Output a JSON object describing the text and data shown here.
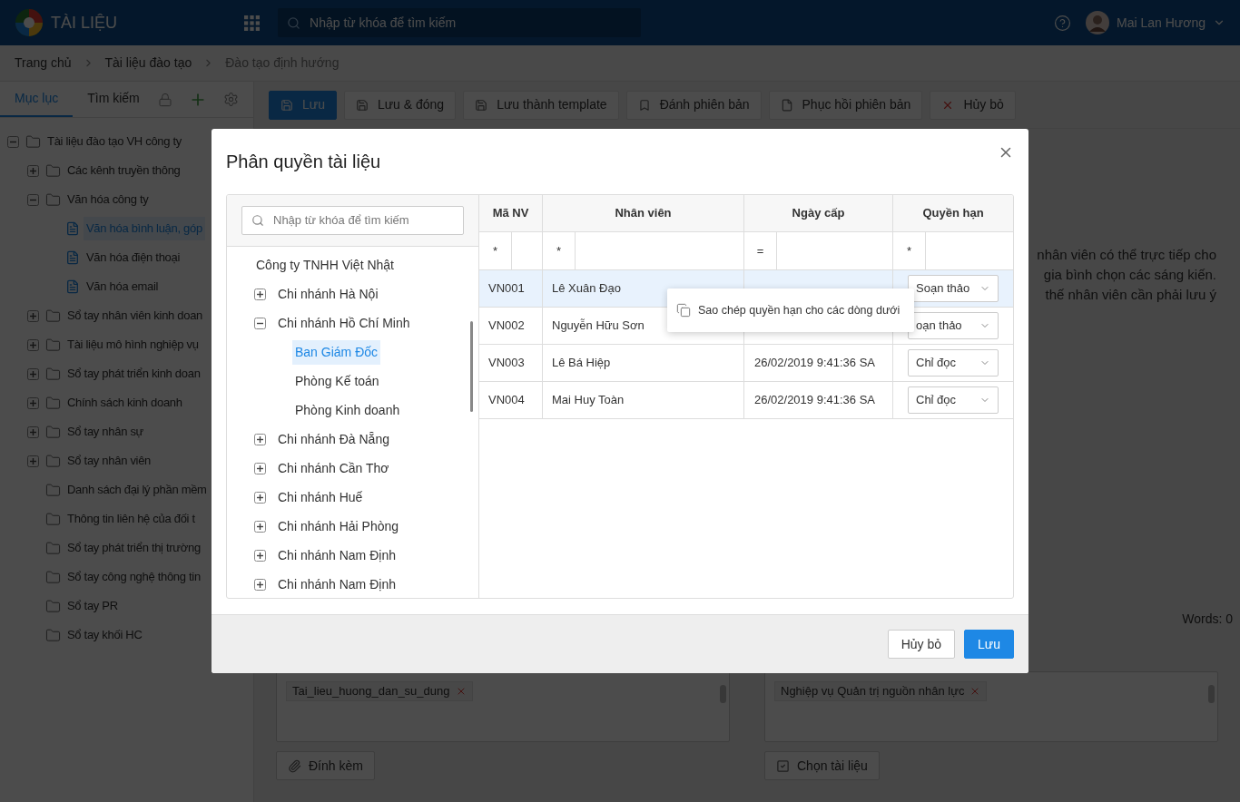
{
  "header": {
    "app_title": "TÀI LIỆU",
    "search_placeholder": "Nhập từ khóa để tìm kiếm",
    "user_name": "Mai Lan Hương"
  },
  "breadcrumb": [
    "Trang chủ",
    "Tài liệu đào tạo",
    "Đào tạo định hướng"
  ],
  "sidebar": {
    "tabs": [
      {
        "label": "Mục lục",
        "selected": true
      },
      {
        "label": "Tìm kiếm",
        "selected": false
      }
    ],
    "tree": [
      {
        "label": "Tài liệu đào tạo VH công ty",
        "kind": "folder",
        "expanded": true,
        "selected": false,
        "children": [
          {
            "label": "Các kênh truyền thông",
            "kind": "folder",
            "expanded": false,
            "selected": false
          },
          {
            "label": "Văn hóa công ty",
            "kind": "folder",
            "expanded": true,
            "selected": false,
            "children": [
              {
                "label": "Văn hóa bình luận, góp",
                "kind": "file",
                "selected": true
              },
              {
                "label": "Văn hóa điện thoại",
                "kind": "file",
                "selected": false
              },
              {
                "label": "Văn hóa email",
                "kind": "file",
                "selected": false
              }
            ]
          },
          {
            "label": "Sổ tay nhân viên kinh doan",
            "kind": "folder",
            "expanded": false,
            "selected": false
          },
          {
            "label": "Tài liệu mô hình nghiệp vụ",
            "kind": "folder",
            "expanded": false,
            "selected": false
          },
          {
            "label": "Sổ tay phát triển kinh doan",
            "kind": "folder",
            "expanded": false,
            "selected": false
          },
          {
            "label": "Chính sách kinh doanh",
            "kind": "folder",
            "expanded": false,
            "selected": false
          },
          {
            "label": "Sổ tay nhân sự",
            "kind": "folder",
            "expanded": false,
            "selected": false
          },
          {
            "label": "Sổ tay nhân viên",
            "kind": "folder",
            "expanded": false,
            "selected": false
          },
          {
            "label": "Danh sách đại lý phần mềm",
            "kind": "folder",
            "selected": false
          },
          {
            "label": "Thông tin liên hệ của đối t",
            "kind": "folder",
            "selected": false
          },
          {
            "label": "Sổ tay phát triển thị trường",
            "kind": "folder",
            "selected": false
          },
          {
            "label": "Sổ tay công nghệ thông tin",
            "kind": "folder",
            "selected": false
          },
          {
            "label": "Sổ tay PR",
            "kind": "folder",
            "selected": false
          },
          {
            "label": "Sổ tay khối HC",
            "kind": "folder",
            "selected": false
          }
        ]
      }
    ]
  },
  "toolbar": [
    {
      "label": "Lưu",
      "kind": "save",
      "primary": true
    },
    {
      "label": "Lưu & đóng",
      "kind": "save",
      "primary": false
    },
    {
      "label": "Lưu thành template",
      "kind": "save",
      "primary": false
    },
    {
      "label": "Đánh phiên bản",
      "kind": "bookmark",
      "primary": false
    },
    {
      "label": "Phục hồi phiên bản",
      "kind": "document",
      "primary": false
    },
    {
      "label": "Hủy bỏ",
      "kind": "cancel",
      "primary": false
    }
  ],
  "content": {
    "text_lines": [
      "nhân viên có thể trực tiếp cho",
      "gia bình chọn các sáng kiến.",
      "thế nhân viên cần phải lưu ý"
    ],
    "word_count": "Words: 0",
    "attachments": {
      "tags": [
        "Tai_lieu_huong_dan_su_dung"
      ],
      "button": "Đính kèm"
    },
    "related_documents": {
      "tags": [
        "Nghiệp vụ Quản trị nguồn nhân lực"
      ],
      "button": "Chọn tài liệu"
    }
  },
  "dialog": {
    "title": "Phân quyền tài liệu",
    "search_placeholder": "Nhập từ khóa để tìm kiếm",
    "tree": [
      {
        "label": "Công ty TNHH Việt Nhật",
        "selected": false,
        "children": [
          {
            "label": "Chi nhánh Hà Nội",
            "expanded": false,
            "selected": false
          },
          {
            "label": "Chi nhánh Hồ Chí Minh",
            "expanded": true,
            "selected": false,
            "children": [
              {
                "label": "Ban Giám Đốc",
                "selected": true
              },
              {
                "label": "Phòng Kế toán",
                "selected": false
              },
              {
                "label": "Phòng Kinh doanh",
                "selected": false
              }
            ]
          },
          {
            "label": "Chi nhánh Đà Nẵng",
            "expanded": false,
            "selected": false
          },
          {
            "label": "Chi nhánh Cần Thơ",
            "expanded": false,
            "selected": false
          },
          {
            "label": "Chi nhánh Huế",
            "expanded": false,
            "selected": false
          },
          {
            "label": "Chi nhánh Hải Phòng",
            "expanded": false,
            "selected": false
          },
          {
            "label": "Chi nhánh Nam Định",
            "expanded": false,
            "selected": false
          },
          {
            "label": "Chi nhánh Nam Định",
            "expanded": false,
            "selected": false
          }
        ]
      }
    ],
    "table": {
      "columns": [
        "Mã NV",
        "Nhân viên",
        "Ngày cấp",
        "Quyền hạn"
      ],
      "filters": [
        "*",
        "*",
        "=",
        "*"
      ],
      "rows": [
        {
          "id": "VN001",
          "name": "Lê Xuân Đạo",
          "permission": "Soạn thảo",
          "selected": true
        },
        {
          "id": "VN002",
          "name": "Nguyễn Hữu Sơn",
          "permission": "oạn thảo",
          "selected": false
        },
        {
          "id": "VN003",
          "name": "Lê Bá Hiệp",
          "date": "26/02/2019 9:41:36 SA",
          "permission": "Chỉ đọc",
          "selected": false
        },
        {
          "id": "VN004",
          "name": "Mai Huy Toàn",
          "date": "26/02/2019 9:41:36 SA",
          "permission": "Chỉ đọc",
          "selected": false
        }
      ]
    },
    "context_menu": {
      "label": "Sao chép quyền hạn cho các dòng dưới"
    },
    "buttons": [
      {
        "label": "Hủy bỏ",
        "primary": false
      },
      {
        "label": "Lưu",
        "primary": true
      }
    ]
  }
}
